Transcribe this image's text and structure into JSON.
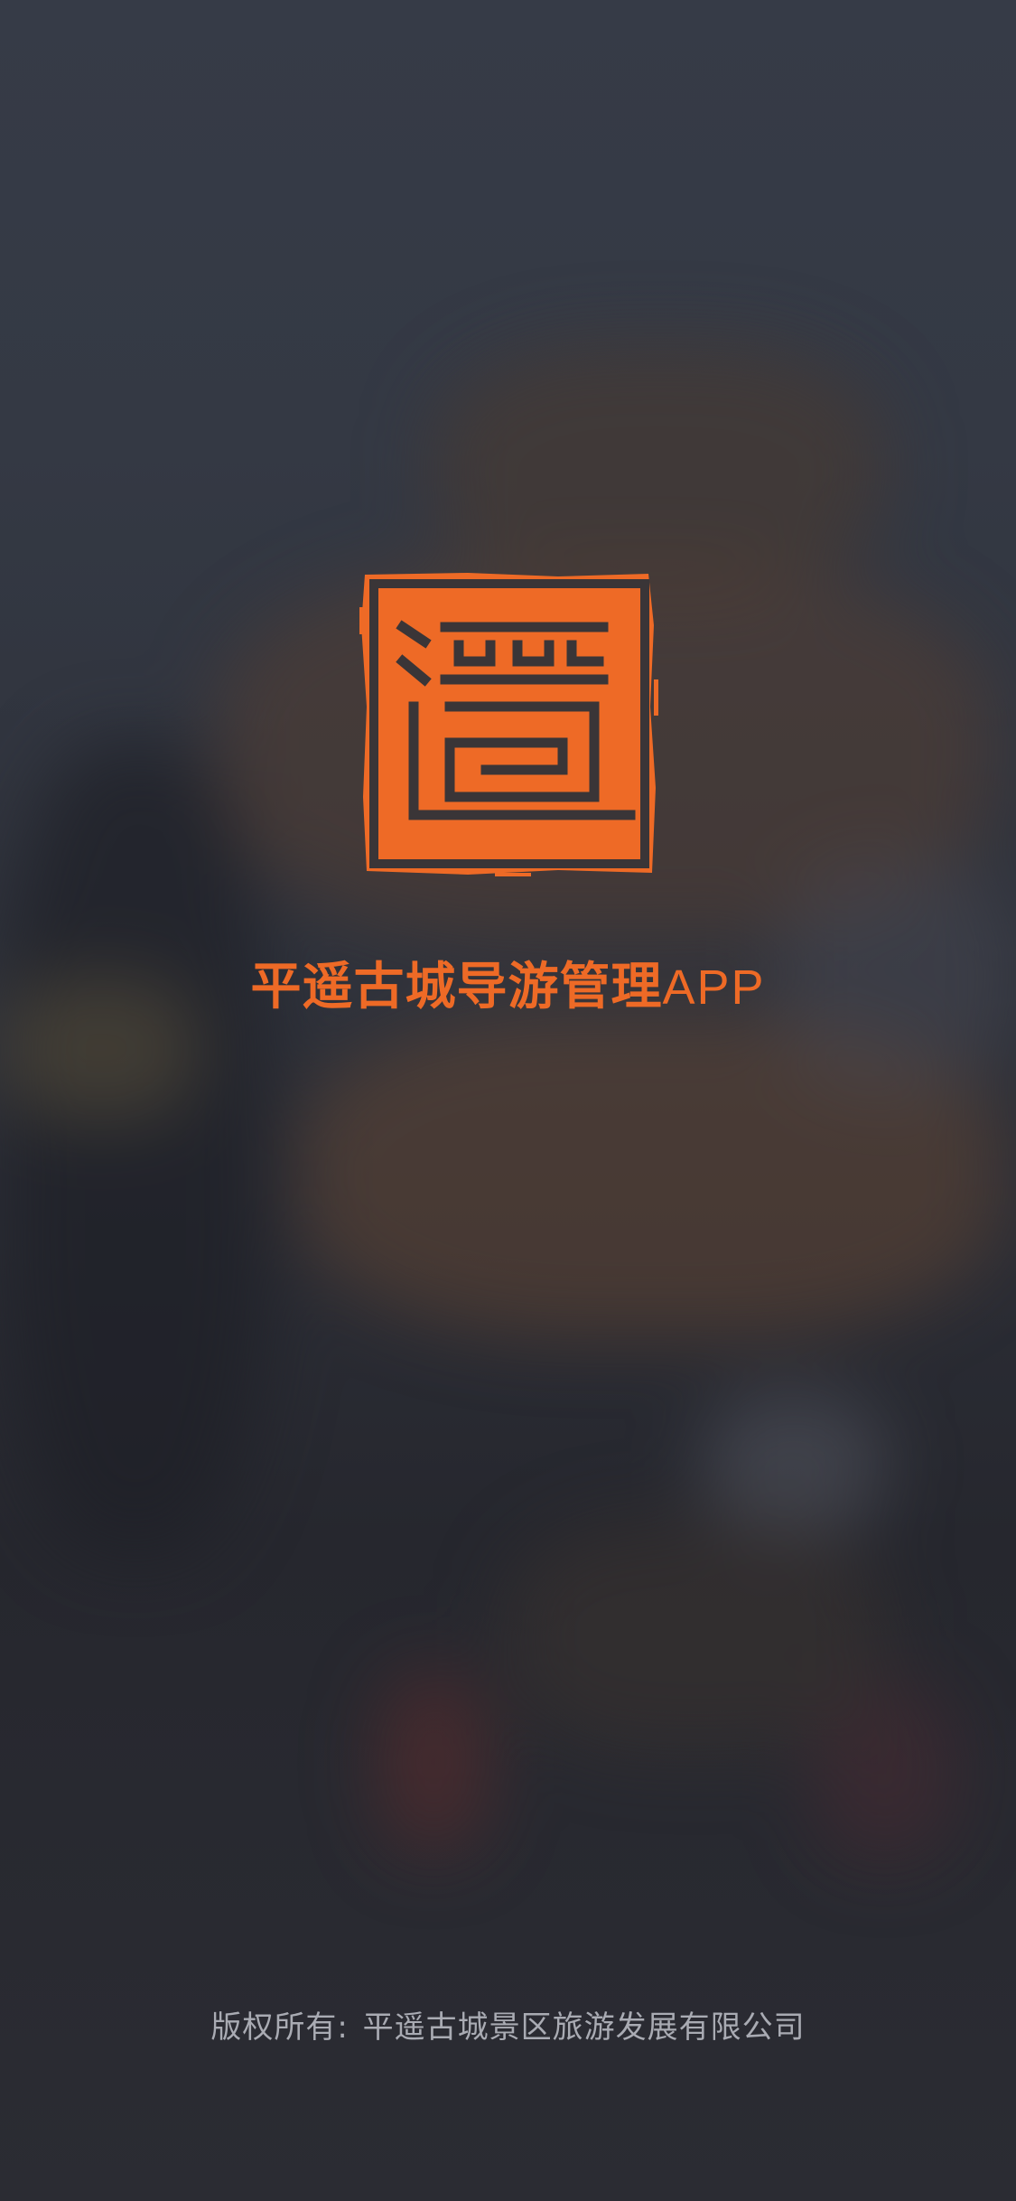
{
  "splash": {
    "app_title_main": "平遥古城导游管理",
    "app_title_suffix": "APP",
    "logo_icon": "seal-logo-icon",
    "brand_color": "#ee6a26",
    "copyright_label": "版权所有:",
    "copyright_owner": "平遥古城景区旅游发展有限公司"
  }
}
